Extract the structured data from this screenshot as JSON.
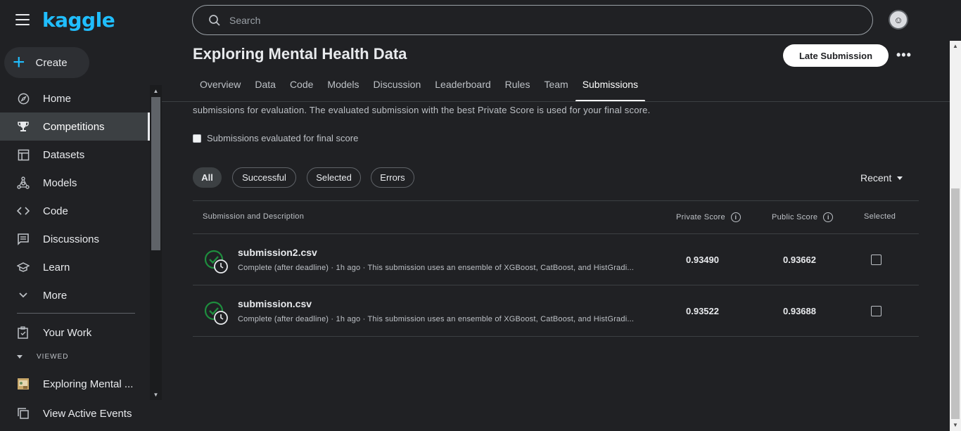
{
  "sidebar": {
    "logo": "kaggle",
    "create_label": "Create",
    "items": [
      {
        "label": "Home",
        "icon": "compass-icon"
      },
      {
        "label": "Competitions",
        "icon": "trophy-icon"
      },
      {
        "label": "Datasets",
        "icon": "table-icon"
      },
      {
        "label": "Models",
        "icon": "models-icon"
      },
      {
        "label": "Code",
        "icon": "code-icon"
      },
      {
        "label": "Discussions",
        "icon": "discussion-icon"
      },
      {
        "label": "Learn",
        "icon": "school-icon"
      },
      {
        "label": "More",
        "icon": "chevron-down-icon"
      }
    ],
    "your_work": "Your Work",
    "viewed_header": "VIEWED",
    "viewed_item": "Exploring Mental ...",
    "view_events": "View Active Events"
  },
  "search": {
    "placeholder": "Search"
  },
  "competition": {
    "title": "Exploring Mental Health Data",
    "late_submission": "Late Submission",
    "tabs": [
      "Overview",
      "Data",
      "Code",
      "Models",
      "Discussion",
      "Leaderboard",
      "Rules",
      "Team",
      "Submissions"
    ],
    "active_tab": "Submissions"
  },
  "submissions": {
    "description": "submissions for evaluation. The evaluated submission with the best Private Score is used for your final score.",
    "final_score_label": "Submissions evaluated for final score",
    "filters": [
      "All",
      "Successful",
      "Selected",
      "Errors"
    ],
    "sort": "Recent",
    "columns": {
      "name": "Submission and Description",
      "private": "Private Score",
      "public": "Public Score",
      "selected": "Selected"
    },
    "rows": [
      {
        "name": "submission2.csv",
        "meta": "Complete (after deadline) · 1h ago · This submission uses an ensemble of XGBoost, CatBoost, and HistGradi...",
        "private": "0.93490",
        "public": "0.93662"
      },
      {
        "name": "submission.csv",
        "meta": "Complete (after deadline) · 1h ago · This submission uses an ensemble of XGBoost, CatBoost, and HistGradi...",
        "private": "0.93522",
        "public": "0.93688"
      }
    ]
  },
  "colors": {
    "background": "#202124",
    "brand": "#20beff",
    "success": "#1e8e3e"
  }
}
